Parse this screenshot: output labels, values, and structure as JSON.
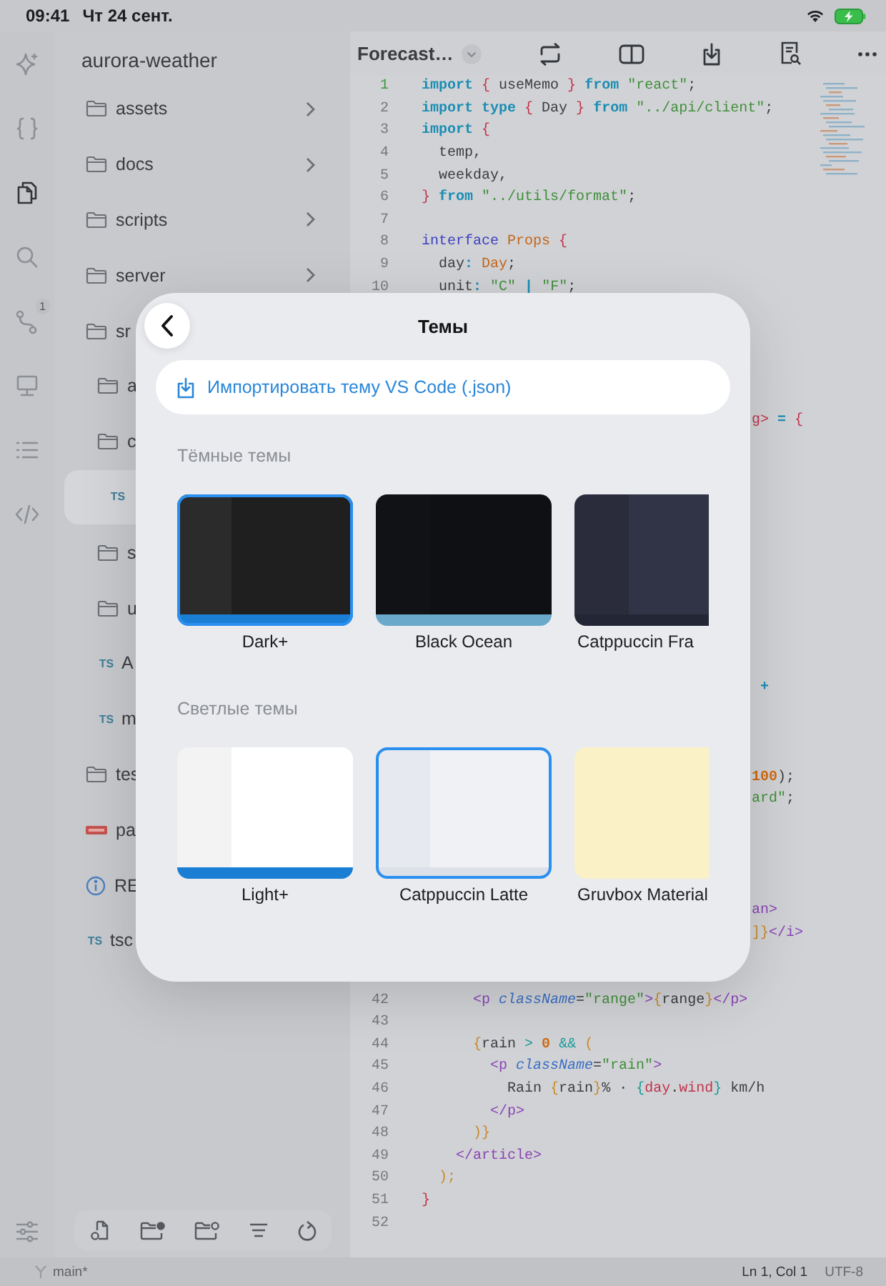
{
  "status_bar": {
    "time": "09:41",
    "date": "Чт 24 сент."
  },
  "rail": {
    "items": [
      {
        "kind": "sparkle",
        "selected": false
      },
      {
        "kind": "braces",
        "selected": false
      },
      {
        "kind": "files",
        "selected": true
      },
      {
        "kind": "search",
        "selected": false
      },
      {
        "kind": "branch",
        "selected": false,
        "badge": "1"
      },
      {
        "kind": "monitor",
        "selected": false
      },
      {
        "kind": "list",
        "selected": false
      },
      {
        "kind": "code",
        "selected": false
      }
    ]
  },
  "sidebar": {
    "title": "aurora-weather",
    "tree": [
      {
        "label": "assets",
        "kind": "folder",
        "chevron": true,
        "selected": false
      },
      {
        "label": "docs",
        "kind": "folder",
        "chevron": true,
        "selected": false
      },
      {
        "label": "scripts",
        "kind": "folder",
        "chevron": true,
        "selected": false
      },
      {
        "label": "server",
        "kind": "folder",
        "chevron": true,
        "selected": false
      },
      {
        "label": "sr",
        "kind": "folder",
        "selected": false,
        "children": [
          {
            "label": "a",
            "kind": "folder",
            "selected": false
          },
          {
            "label": "c",
            "kind": "folder",
            "selected": false,
            "children": [
              {
                "kind": "file",
                "icon_text": "TS",
                "selected": true
              }
            ]
          },
          {
            "label": "s",
            "kind": "folder",
            "selected": false
          },
          {
            "label": "u",
            "kind": "folder",
            "selected": false
          },
          {
            "label": "A",
            "kind": "file",
            "icon_text": "TS",
            "selected": false
          },
          {
            "label": "m",
            "kind": "file",
            "icon_text": "TS",
            "selected": false
          }
        ]
      },
      {
        "label": "tes",
        "kind": "folder",
        "selected": false
      },
      {
        "label": "pa",
        "kind": "package",
        "selected": false
      },
      {
        "label": "RE",
        "kind": "info",
        "selected": false
      },
      {
        "label": "tsc",
        "kind": "file",
        "icon_text": "TS",
        "selected": false
      }
    ]
  },
  "editor": {
    "tab": "Forecast…",
    "lines_above": [
      {
        "number": "1",
        "current": true,
        "tokens": [
          {
            "text": "import",
            "kind": "kw"
          },
          {
            "text": " { ",
            "kind": "red"
          },
          {
            "text": "useMemo",
            "kind": "plain"
          },
          {
            "text": " } ",
            "kind": "red"
          },
          {
            "text": "from",
            "kind": "kw"
          },
          {
            "text": " \"react\"",
            "kind": "str"
          },
          {
            "text": ";",
            "kind": "plain"
          }
        ]
      },
      {
        "number": "2",
        "current": false,
        "tokens": [
          {
            "text": "import type",
            "kind": "kw"
          },
          {
            "text": " { ",
            "kind": "red"
          },
          {
            "text": "Day",
            "kind": "plain"
          },
          {
            "text": " } ",
            "kind": "red"
          },
          {
            "text": "from",
            "kind": "kw"
          },
          {
            "text": " \"../api/client\"",
            "kind": "str"
          },
          {
            "text": ";",
            "kind": "plain"
          }
        ]
      },
      {
        "number": "3",
        "current": false,
        "tokens": [
          {
            "text": "import",
            "kind": "kw"
          },
          {
            "text": " {",
            "kind": "red"
          }
        ]
      },
      {
        "number": "4",
        "current": false,
        "tokens": [
          {
            "text": "  temp,",
            "kind": "plain"
          }
        ]
      },
      {
        "number": "5",
        "current": false,
        "tokens": [
          {
            "text": "  weekday,",
            "kind": "plain"
          }
        ]
      },
      {
        "number": "6",
        "current": false,
        "tokens": [
          {
            "text": "} ",
            "kind": "red"
          },
          {
            "text": "from",
            "kind": "kw"
          },
          {
            "text": " \"../utils/format\"",
            "kind": "str"
          },
          {
            "text": ";",
            "kind": "plain"
          }
        ]
      },
      {
        "number": "7",
        "current": false
      },
      {
        "number": "8",
        "current": false,
        "tokens": [
          {
            "text": "interface",
            "kind": "kw2"
          },
          {
            "text": " Props",
            "kind": "type"
          },
          {
            "text": " {",
            "kind": "red"
          }
        ]
      },
      {
        "number": "9",
        "current": false,
        "tokens": [
          {
            "text": "  day",
            "kind": "plain"
          },
          {
            "text": ":",
            "kind": "kw"
          },
          {
            "text": " Day",
            "kind": "type"
          },
          {
            "text": ";",
            "kind": "plain"
          }
        ]
      },
      {
        "number": "10",
        "current": false,
        "tokens": [
          {
            "text": "  unit",
            "kind": "plain"
          },
          {
            "text": ":",
            "kind": "kw"
          },
          {
            "text": " \"C\"",
            "kind": "str"
          },
          {
            "text": " | ",
            "kind": "kw"
          },
          {
            "text": "\"F\"",
            "kind": "str"
          },
          {
            "text": ";",
            "kind": "plain"
          }
        ]
      }
    ],
    "covered_tails": [
      {
        "tokens": [
          {
            "text": "g>",
            "kind": "red"
          },
          {
            "text": " = ",
            "kind": "kw"
          },
          {
            "text": "{",
            "kind": "red"
          }
        ]
      },
      {
        "tokens": [
          {
            "text": " +",
            "kind": "kw"
          }
        ]
      },
      {
        "tokens": [
          {
            "text": "100",
            "kind": "num"
          },
          {
            "text": ");",
            "kind": "plain"
          }
        ]
      },
      {
        "tokens": [
          {
            "text": "ard\"",
            "kind": "str"
          },
          {
            "text": ";",
            "kind": "plain"
          }
        ]
      },
      {
        "tokens": [
          {
            "text": "an>",
            "kind": "tag"
          }
        ]
      },
      {
        "tokens": [
          {
            "text": "]}",
            "kind": "brace"
          },
          {
            "text": "</i>",
            "kind": "tag"
          }
        ]
      }
    ],
    "lines_below": [
      {
        "number": "42",
        "current": false,
        "tokens": [
          {
            "text": "      <p ",
            "kind": "tag"
          },
          {
            "text": "className",
            "kind": "attr"
          },
          {
            "text": "=",
            "kind": "plain"
          },
          {
            "text": "\"range\"",
            "kind": "str"
          },
          {
            "text": ">",
            "kind": "tag"
          },
          {
            "text": "{",
            "kind": "brace"
          },
          {
            "text": "range",
            "kind": "plain"
          },
          {
            "text": "}",
            "kind": "brace"
          },
          {
            "text": "</p>",
            "kind": "tag"
          }
        ]
      },
      {
        "number": "43",
        "current": false
      },
      {
        "number": "44",
        "current": false,
        "tokens": [
          {
            "text": "      {",
            "kind": "brace"
          },
          {
            "text": "rain ",
            "kind": "plain"
          },
          {
            "text": "> ",
            "kind": "op"
          },
          {
            "text": "0",
            "kind": "num"
          },
          {
            "text": " &&",
            "kind": "op"
          },
          {
            "text": " (",
            "kind": "brace"
          }
        ]
      },
      {
        "number": "45",
        "current": false,
        "tokens": [
          {
            "text": "        <p ",
            "kind": "tag"
          },
          {
            "text": "className",
            "kind": "attr"
          },
          {
            "text": "=",
            "kind": "plain"
          },
          {
            "text": "\"rain\"",
            "kind": "str"
          },
          {
            "text": ">",
            "kind": "tag"
          }
        ]
      },
      {
        "number": "46",
        "current": false,
        "tokens": [
          {
            "text": "          Rain ",
            "kind": "plain"
          },
          {
            "text": "{",
            "kind": "brace"
          },
          {
            "text": "rain",
            "kind": "plain"
          },
          {
            "text": "}",
            "kind": "brace"
          },
          {
            "text": "% · ",
            "kind": "plain"
          },
          {
            "text": "{",
            "kind": "op"
          },
          {
            "text": "day",
            "kind": "red"
          },
          {
            "text": ".",
            "kind": "plain"
          },
          {
            "text": "wind",
            "kind": "red"
          },
          {
            "text": "}",
            "kind": "op"
          },
          {
            "text": " km/h",
            "kind": "plain"
          }
        ]
      },
      {
        "number": "47",
        "current": false,
        "tokens": [
          {
            "text": "        </p>",
            "kind": "tag"
          }
        ]
      },
      {
        "number": "48",
        "current": false,
        "tokens": [
          {
            "text": "      )}",
            "kind": "brace"
          }
        ]
      },
      {
        "number": "49",
        "current": false,
        "tokens": [
          {
            "text": "    </article>",
            "kind": "tag"
          }
        ]
      },
      {
        "number": "50",
        "current": false,
        "tokens": [
          {
            "text": "  );",
            "kind": "brace"
          }
        ]
      },
      {
        "number": "51",
        "current": false,
        "tokens": [
          {
            "text": "}",
            "kind": "red"
          }
        ]
      },
      {
        "number": "52",
        "current": false
      }
    ]
  },
  "footer": {
    "branch": "main*",
    "position": "Ln 1, Col 1",
    "encoding": "UTF-8"
  },
  "dialog": {
    "title": "Темы",
    "import_label": "Импортировать тему VS Code (.json)",
    "sections": [
      {
        "title": "Тёмные темы",
        "themes": [
          {
            "name": "Dark+",
            "selected": true,
            "sidebar": {
              "color": "#2b2b2b"
            },
            "editor": {
              "color": "#1f1f1f"
            },
            "status_bar": {
              "color": "#1a7fd4"
            }
          },
          {
            "name": "Black Ocean",
            "selected": false,
            "sidebar": {
              "color": "#101215"
            },
            "editor": {
              "color": "#0e1013"
            },
            "status_bar": {
              "color": "#6aa9c9"
            }
          },
          {
            "name": "Catppuccin Fra",
            "selected": false,
            "sidebar": {
              "color": "#2a2c3b"
            },
            "editor": {
              "color": "#303446"
            },
            "status_bar": {
              "color": "#232634"
            }
          }
        ]
      },
      {
        "title": "Светлые темы",
        "themes": [
          {
            "name": "Light+",
            "selected": false,
            "sidebar": {
              "color": "#f3f3f3"
            },
            "editor": {
              "color": "#ffffff"
            },
            "status_bar": {
              "color": "#1a7fd4"
            }
          },
          {
            "name": "Catppuccin Latte",
            "selected": true,
            "sidebar": {
              "color": "#e6e9ef"
            },
            "editor": {
              "color": "#eff1f5"
            },
            "status_bar": {
              "color": "#dce0e8"
            }
          },
          {
            "name": "Gruvbox Material",
            "selected": false,
            "sidebar": {
              "color": "#fbf1c7"
            },
            "editor": {
              "color": "#fbf1c7"
            },
            "status_bar": {
              "color": "#fbf1c7"
            }
          }
        ]
      }
    ]
  }
}
